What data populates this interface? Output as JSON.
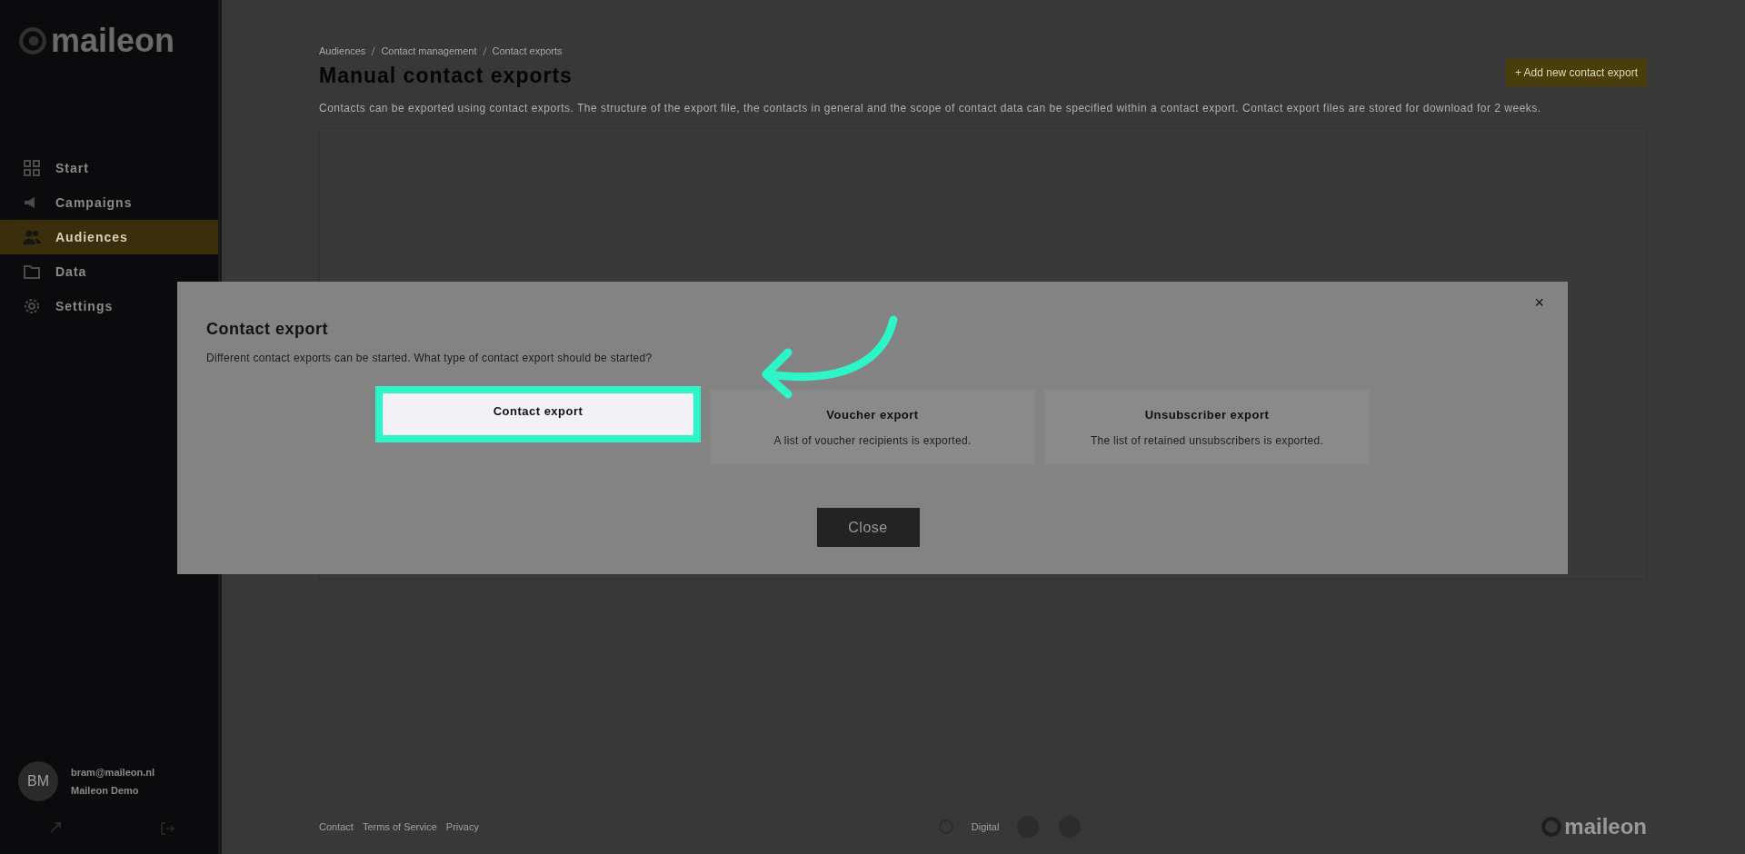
{
  "sidebar": {
    "logo": "maileon",
    "items": [
      {
        "label": "Start",
        "selected": false
      },
      {
        "label": "Campaigns",
        "selected": false
      },
      {
        "label": "Audiences",
        "selected": true
      },
      {
        "label": "Data",
        "selected": false
      },
      {
        "label": "Settings",
        "selected": false
      }
    ],
    "user": {
      "initials": "BM",
      "email": "bram@maileon.nl",
      "account": "Maileon Demo"
    }
  },
  "page": {
    "breadcrumb": [
      "Audiences",
      "Contact management",
      "Contact exports"
    ],
    "title": "Manual contact exports",
    "description": "Contacts can be exported using contact exports. The structure of the export file, the contacts in general and the scope of contact data can be specified within a contact export. Contact export files are stored for download for 2 weeks.",
    "add_button": {
      "icon": "+",
      "label": "Add new contact export"
    }
  },
  "footer": {
    "links": [
      "Contact",
      "Terms of Service",
      "Privacy"
    ],
    "badge_label": "Digital",
    "logo": "maileon"
  },
  "dialog": {
    "title": "Contact export",
    "text": "Different contact exports can be started. What type of contact export should be started?",
    "close_icon": "×",
    "options": [
      {
        "title": "Contact export",
        "highlighted": true
      },
      {
        "title": "Voucher export",
        "description": "A list of voucher recipients is exported.",
        "highlighted": false
      },
      {
        "title": "Unsubscriber export",
        "description": "The list of retained unsubscribers is exported.",
        "highlighted": false
      }
    ],
    "close_button": "Close"
  }
}
